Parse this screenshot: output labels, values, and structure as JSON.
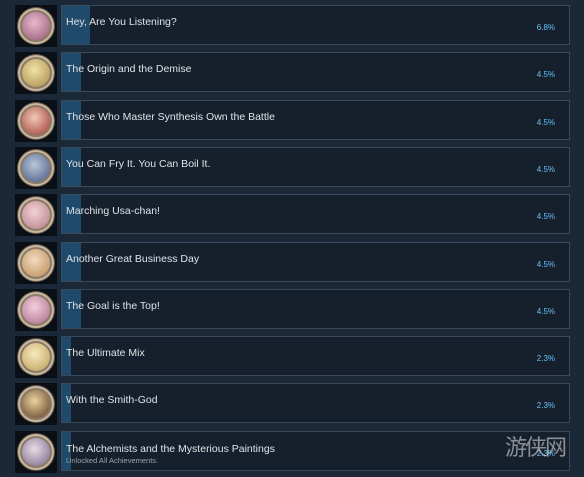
{
  "achievements": [
    {
      "title": "Hey, Are You Listening?",
      "percent_label": "6.8%",
      "percent": 6.8,
      "icon": "achievement-medal-portrait-icon",
      "tint": [
        "#e7b9c8",
        "#a66b8a"
      ]
    },
    {
      "title": "The Origin and the Demise",
      "percent_label": "4.5%",
      "percent": 4.5,
      "icon": "achievement-medal-portrait-icon",
      "tint": [
        "#efe3a6",
        "#b89b5c"
      ]
    },
    {
      "title": "Those Who Master Synthesis Own the Battle",
      "percent_label": "4.5%",
      "percent": 4.5,
      "icon": "achievement-medal-portrait-icon",
      "tint": [
        "#f0c9b6",
        "#b0574e"
      ]
    },
    {
      "title": "You Can Fry It. You Can Boil It.",
      "percent_label": "4.5%",
      "percent": 4.5,
      "icon": "achievement-medal-portrait-icon",
      "tint": [
        "#b9c6d8",
        "#5d6f95"
      ]
    },
    {
      "title": "Marching Usa-chan!",
      "percent_label": "4.5%",
      "percent": 4.5,
      "icon": "achievement-medal-portrait-icon",
      "tint": [
        "#f3d1d6",
        "#c08e96"
      ]
    },
    {
      "title": "Another Great Business Day",
      "percent_label": "4.5%",
      "percent": 4.5,
      "icon": "achievement-medal-portrait-icon",
      "tint": [
        "#f4dcc0",
        "#c49a6a"
      ]
    },
    {
      "title": "The Goal is the Top!",
      "percent_label": "4.5%",
      "percent": 4.5,
      "icon": "achievement-medal-portrait-icon",
      "tint": [
        "#f2cfdc",
        "#b97f98"
      ]
    },
    {
      "title": "The Ultimate Mix",
      "percent_label": "2.3%",
      "percent": 2.3,
      "icon": "achievement-medal-portrait-icon",
      "tint": [
        "#f6e8c0",
        "#c9ae6b"
      ]
    },
    {
      "title": "With the Smith-God",
      "percent_label": "2.3%",
      "percent": 2.3,
      "icon": "achievement-medal-portrait-icon",
      "tint": [
        "#e9d3a0",
        "#7a5a3c"
      ]
    },
    {
      "title": "The Alchemists and the Mysterious Paintings",
      "subtitle": "Unlocked All Achievements.",
      "percent_label": "2.3%",
      "percent": 2.3,
      "icon": "achievement-medal-portrait-icon",
      "tint": [
        "#e6dce6",
        "#8f7f9a"
      ]
    }
  ],
  "watermark": {
    "text": "游侠网",
    "icon": "watermark-logo"
  }
}
